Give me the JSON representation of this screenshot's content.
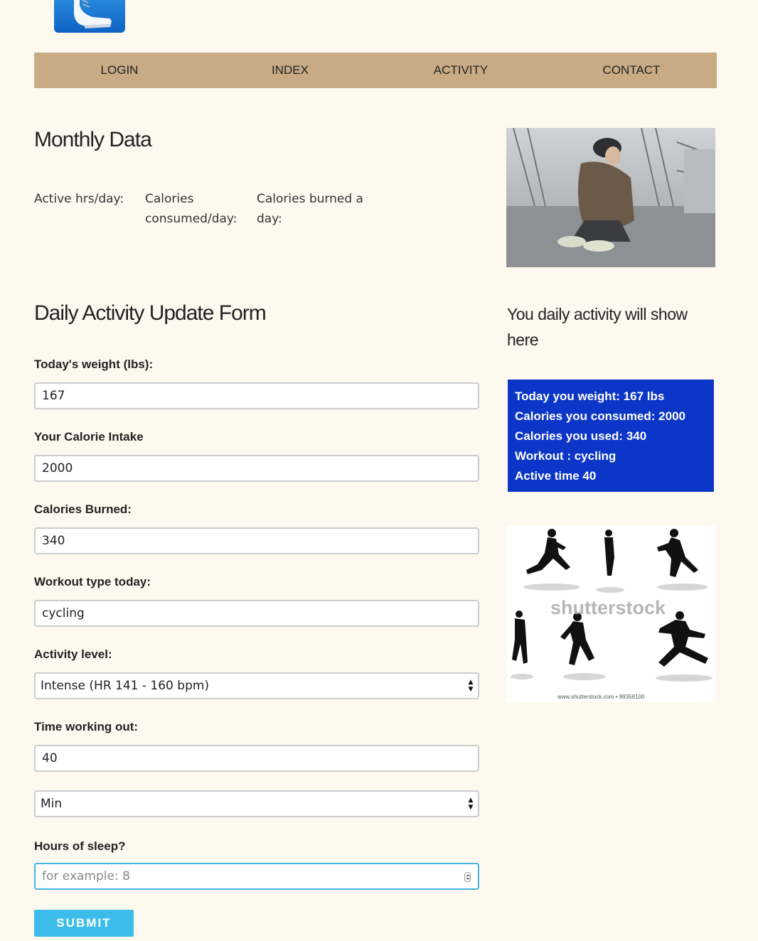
{
  "nav": {
    "items": [
      "LOGIN",
      "INDEX",
      "ACTIVITY",
      "CONTACT"
    ]
  },
  "monthly": {
    "title": "Monthly Data",
    "stats": [
      {
        "label_line1": "Active hrs/day:",
        "label_line2": ""
      },
      {
        "label_line1": "Calories",
        "label_line2": "consumed/day:"
      },
      {
        "label_line1": "Calories burned a",
        "label_line2": "day:"
      }
    ]
  },
  "form": {
    "title": "Daily Activity Update Form",
    "weight_label": "Today's weight (lbs):",
    "weight_value": "167",
    "intake_label": "Your Calorie Intake",
    "intake_value": "2000",
    "burned_label": "Calories Burned:",
    "burned_value": "340",
    "workout_label": "Workout type today:",
    "workout_value": "cycling",
    "activity_label": "Activity level:",
    "activity_value": "Intense (HR 141 - 160 bpm)",
    "time_label": "Time working out:",
    "time_value": "40",
    "time_unit_value": "Min",
    "sleep_label": "Hours of sleep?",
    "sleep_placeholder": "for example: 8",
    "submit_label": "SUBMIT"
  },
  "activity": {
    "caption": "You daily activity will show here",
    "summary_lines": [
      "Today you weight: 167 lbs",
      "Calories you consumed: 2000",
      "Calories you used: 340",
      "Workout : cycling",
      "Active time 40"
    ]
  },
  "images": {
    "watermark": "shutterstock",
    "watermark_small": "www.shutterstock.com • 99358100"
  },
  "colors": {
    "background": "#fdf9ee",
    "nav": "#c8ab84",
    "summary": "#0c36c7",
    "submit": "#3cbde9"
  }
}
